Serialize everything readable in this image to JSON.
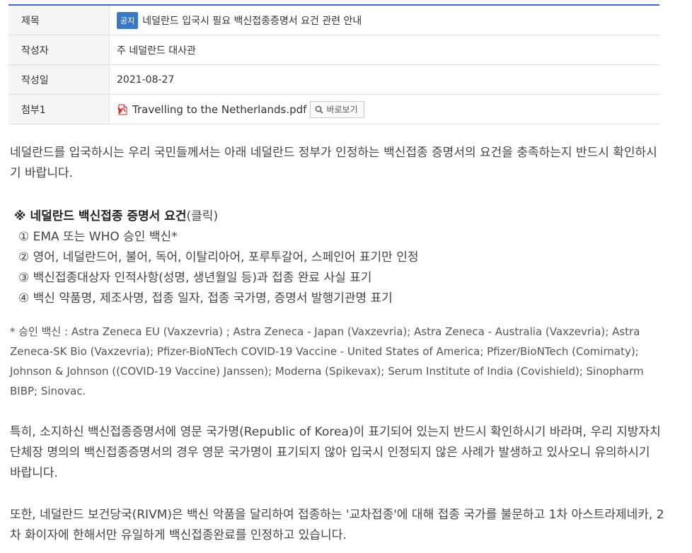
{
  "meta": {
    "title_label": "제목",
    "notice_badge": "공지",
    "title": "네덜란드 입국시 필요 백신접종증명서 요건 관련 안내",
    "author_label": "작성자",
    "author": "주 네덜란드 대사관",
    "date_label": "작성일",
    "date": "2021-08-27",
    "attachment_label": "첨부1",
    "attachment_name": "Travelling to the Netherlands.pdf",
    "view_button": "바로보기"
  },
  "body": {
    "intro": "네덜란드를 입국하시는 우리 국민들께서는 아래 네덜란드 정부가 인정하는 백신접종 증명서의 요건을 충족하는지 반드시 확인하시기 바랍니다.",
    "req_title": "※ 네덜란드 백신접종 증명서 요건",
    "req_click": "(클릭)",
    "requirements": [
      "① EMA 또는 WHO 승인 백신*",
      "② 영어, 네덜란드어, 불어, 독어, 이탈리아어, 포루투갈어, 스페인어 표기만 인정",
      "③ 백신접종대상자 인적사항(성명, 생년월일 등)과 접종 완료 사실 표기",
      "④ 백신 약품명, 제조사명, 접종 일자, 접종 국가명, 증명서 발행기관명 표기"
    ],
    "vaccine_note": "* 승인 백신 : Astra Zeneca EU (Vaxzevria) ; Astra Zeneca - Japan (Vaxzevria); Astra Zeneca - Australia (Vaxzevria); Astra Zeneca-SK Bio (Vaxzevria); Pfizer-BioNTech COVID-19 Vaccine - United States of America; Pfizer/BioNTech (Comirnaty); Johnson & Johnson ((COVID-19 Vaccine) Janssen); Moderna (Spikevax); Serum Institute of India (Covishield); Sinopharm BIBP; Sinovac.",
    "para_country": "특히, 소지하신 백신접종증명서에 영문 국가명(Republic of Korea)이 표기되어 있는지 반드시 확인하시기 바라며, 우리 지방자치단체장 명의의 백신접종증명서의 경우 영문 국가명이 표기되지 않아 입국시 인정되지 않은 사례가 발생하고 있사오니 유의하시기 바랍니다.",
    "para_rivm": "또한, 네덜란드 보건당국(RIVM)은 백신 악품을 달리하여 접종하는 '교차접종'에 대해 접종 국가를 불문하고 1차 아스트라제네카, 2차 화이자에 한해서만 유일하게 백신접종완료를 인정하고 있습니다."
  },
  "colors": {
    "table_top_border": "#3b6cab",
    "badge_bg": "#3b78c2",
    "header_bg": "#f5f5f5"
  }
}
